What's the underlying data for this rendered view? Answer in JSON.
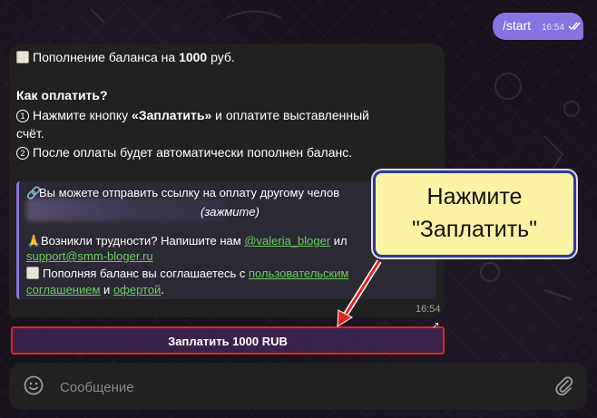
{
  "outgoing": {
    "text": "/start",
    "time": "16:54"
  },
  "message": {
    "line1_prefix": "Пополнение баланса на ",
    "line1_amount": "1000",
    "line1_suffix": " руб.",
    "how_title": "Как оплатить?",
    "step1_num": "1",
    "step1_a": "Нажмите кнопку ",
    "step1_b": "«Заплатить»",
    "step1_c": " и оплатите выставленный",
    "step1_d": "счёт.",
    "step2_num": "2",
    "step2": "После оплаты будет автоматически пополнен баланс.",
    "quote": {
      "share_text": "Вы можете отправить ссылку на оплату другому челов",
      "hold_hint": "(зажмите)",
      "trouble_text": "Возникли трудности? Напишите нам ",
      "trouble_link": "@valeria_bloger",
      "trouble_or": " ил",
      "email": "support@smm-bloger.ru",
      "agree_text": "Пополняя баланс вы соглашаетесь с ",
      "agree_link1a": "пользовательск",
      "agree_link1b": "им",
      "agree_link1c": "соглашением",
      "agree_and": " и ",
      "agree_link2": "офертой",
      "agree_end": "."
    },
    "time": "16:54"
  },
  "pay_button": {
    "label": "Заплатить 1000 RUB",
    "corner_icon": "arrow-up-right-icon"
  },
  "composer": {
    "placeholder": "Сообщение",
    "left_icon": "smile-icon",
    "right_icon": "paperclip-icon"
  },
  "callout": {
    "line1": "Нажмите",
    "line2": "\"Заплатить\"",
    "fill": "#fbf2a3",
    "border": "#2a3a9c"
  },
  "colors": {
    "accent": "#8774e1",
    "link": "#6ccb5f",
    "highlight": "#e0261f",
    "bubble": "#212121"
  }
}
